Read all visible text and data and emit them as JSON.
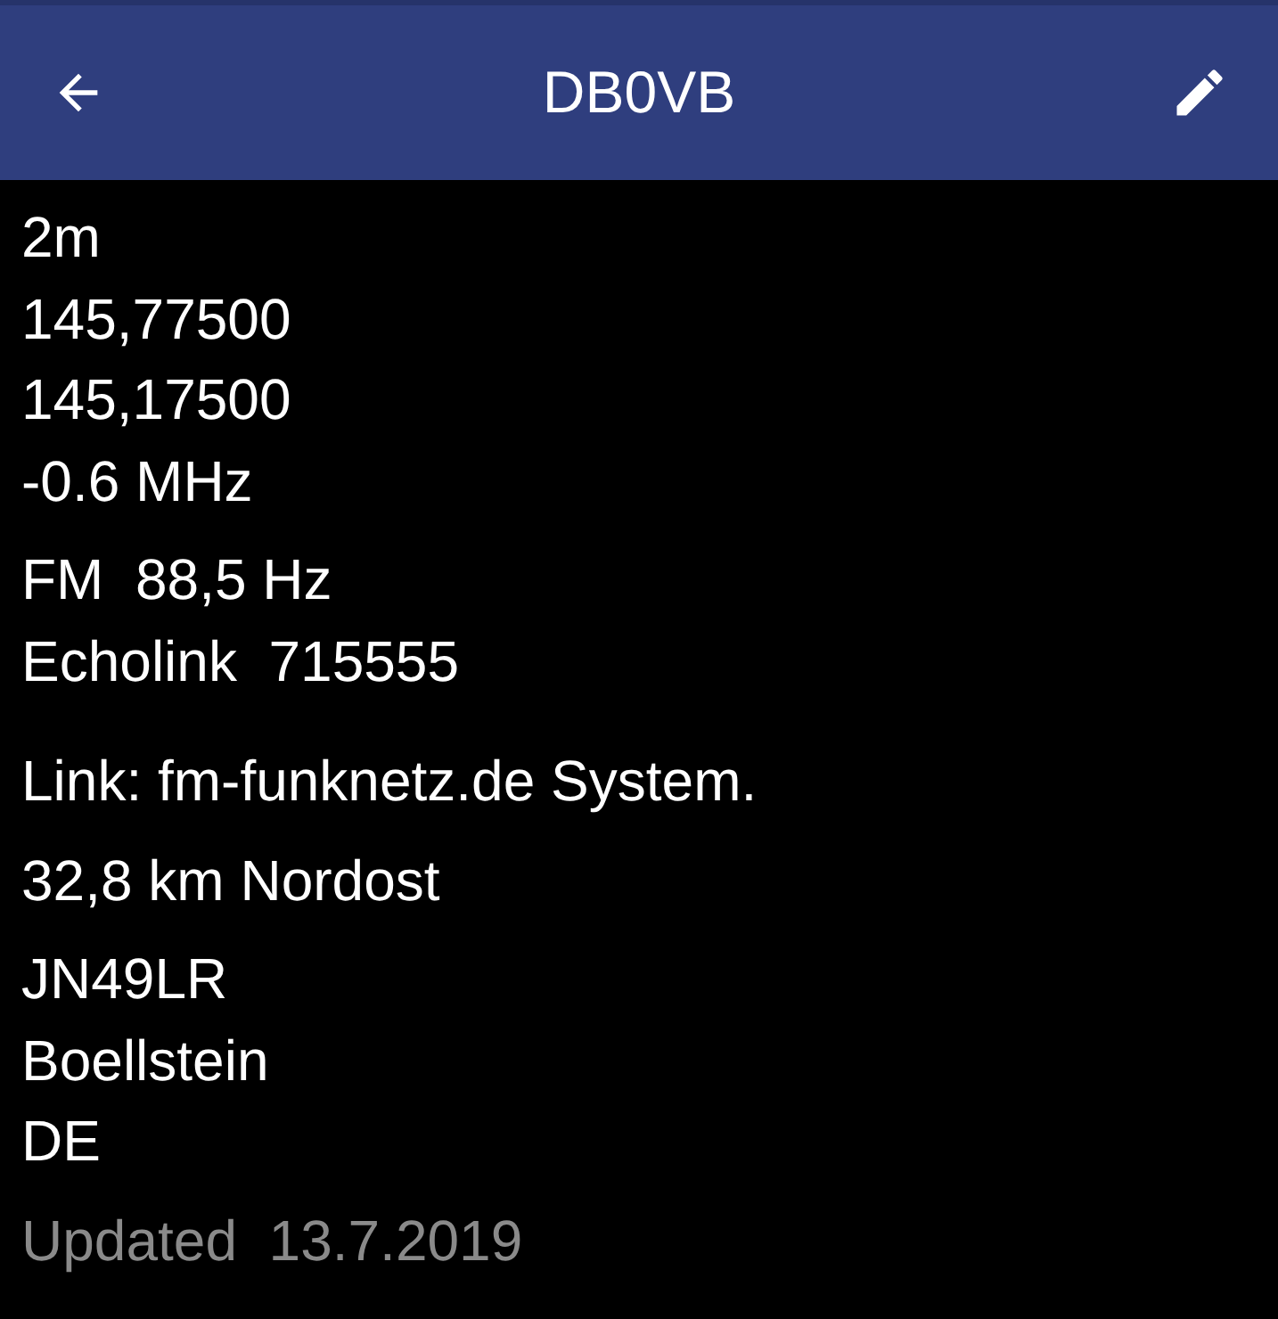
{
  "app_bar": {
    "title": "DB0VB"
  },
  "groups": [
    {
      "kind": "info",
      "lines": [
        "2m",
        "145,77500",
        "145,17500",
        "-0.6 MHz"
      ]
    },
    {
      "kind": "info",
      "lines": [
        "FM  88,5 Hz",
        "Echolink  715555"
      ]
    },
    {
      "kind": "info",
      "lines": [
        "Link: fm-funknetz.de System."
      ]
    },
    {
      "kind": "info",
      "lines": [
        "32,8 km Nordost"
      ]
    },
    {
      "kind": "info",
      "lines": [
        "JN49LR",
        "Boellstein",
        "DE"
      ]
    },
    {
      "kind": "muted",
      "lines": [
        "Updated  13.7.2019"
      ]
    }
  ]
}
